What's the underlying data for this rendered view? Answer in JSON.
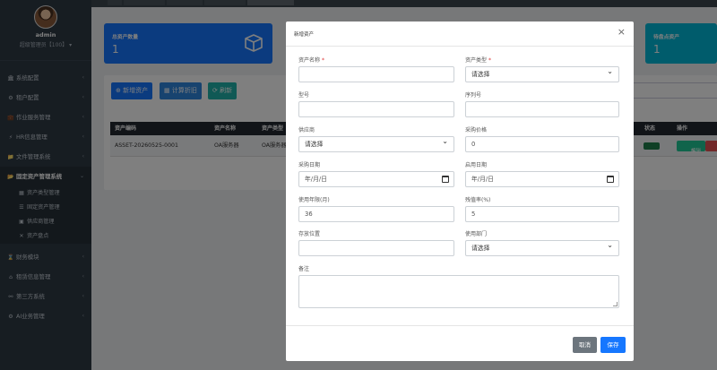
{
  "sidebar": {
    "user_name": "admin",
    "user_role": "超级管理员【100】",
    "items": [
      {
        "label": "系统配置",
        "icon": "bank-icon"
      },
      {
        "label": "租户配置",
        "icon": "cog-icon"
      },
      {
        "label": "作业服务管理",
        "icon": "briefcase-icon"
      },
      {
        "label": "HR信息管理",
        "icon": "bolt-icon"
      },
      {
        "label": "文件管理系统",
        "icon": "folder-icon"
      },
      {
        "label": "固定资产管理系统",
        "icon": "folder-open-icon",
        "active": true
      },
      {
        "label": "资产类型管理",
        "icon": "grid-icon",
        "sub": true
      },
      {
        "label": "固定资产管理",
        "icon": "list-icon",
        "sub": true
      },
      {
        "label": "供应商管理",
        "icon": "truck-icon",
        "sub": true
      },
      {
        "label": "资产盘点",
        "icon": "tools-icon",
        "sub": true
      },
      {
        "label": "财务模块",
        "icon": "hourglass-icon"
      },
      {
        "label": "租赁信息管理",
        "icon": "home-icon"
      },
      {
        "label": "第三方系统",
        "icon": "network-icon"
      },
      {
        "label": "AI业务管理",
        "icon": "gear-icon"
      }
    ]
  },
  "cards": {
    "total_title": "总资产数量",
    "total_value": "1",
    "pending_title": "待盘点资产",
    "pending_value": "1"
  },
  "toolbar": {
    "add_label": "新增资产",
    "calc_label": "计算折旧",
    "refresh_label": "刷新"
  },
  "table": {
    "headers": [
      "资产编码",
      "资产名称",
      "资产类型",
      "状态",
      "操作"
    ],
    "row": {
      "code": "ASSET-20260525-0001",
      "name": "OA服务器",
      "type": "OA服务器",
      "edit": "编辑"
    }
  },
  "modal": {
    "title": "新增资产",
    "fields": {
      "asset_name": "资产名称",
      "asset_type": "资产类型",
      "type_select": "请选择",
      "model": "型号",
      "serial": "序列号",
      "supplier": "供应商",
      "supplier_select": "请选择",
      "price": "采购价格",
      "price_value": "0",
      "purchase_date": "采购日期",
      "purchase_date_ph": "年/月/日",
      "enable_date": "启用日期",
      "enable_date_ph": "年/月/日",
      "years": "使用年限(月)",
      "years_value": "36",
      "residual": "残值率(%)",
      "residual_value": "5",
      "location": "存放位置",
      "dept": "使用部门",
      "dept_select": "请选择",
      "remark": "备注"
    },
    "cancel_label": "取消",
    "save_label": "保存"
  },
  "colors": {
    "sidebar_bg": "#2f3a45",
    "card_blue": "#1677ff",
    "card_cyan": "#00b8d9",
    "save_blue": "#1677ff",
    "cancel_gray": "#6c757d"
  }
}
